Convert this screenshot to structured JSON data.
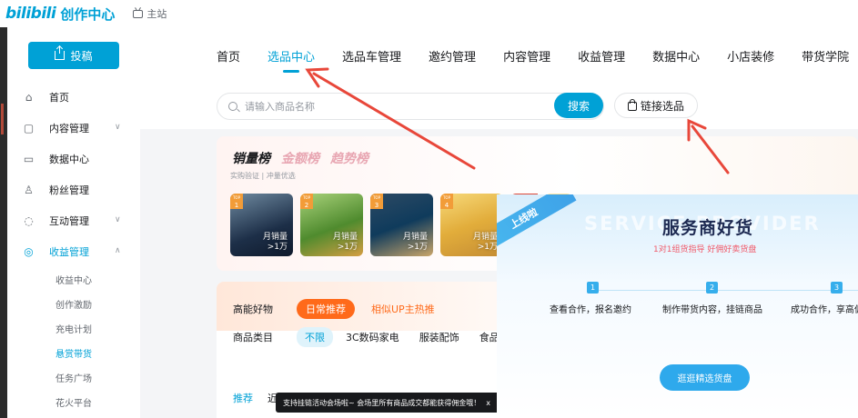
{
  "header": {
    "logo_mark": "bilibili",
    "logo_text": "创作中心",
    "home_link": "主站"
  },
  "sidebar": {
    "upload_label": "投稿",
    "items": [
      {
        "label": "首页",
        "icon": "home-icon"
      },
      {
        "label": "内容管理",
        "icon": "content-icon",
        "chevron": "∨"
      },
      {
        "label": "数据中心",
        "icon": "data-icon"
      },
      {
        "label": "粉丝管理",
        "icon": "fans-icon"
      },
      {
        "label": "互动管理",
        "icon": "interact-icon",
        "chevron": "∨"
      },
      {
        "label": "收益管理",
        "icon": "revenue-icon",
        "chevron": "∧"
      }
    ],
    "sub_items": [
      "收益中心",
      "创作激励",
      "充电计划",
      "悬赏带货",
      "任务广场",
      "花火平台"
    ]
  },
  "tabs": [
    "首页",
    "选品中心",
    "选品车管理",
    "邀约管理",
    "内容管理",
    "收益管理",
    "数据中心",
    "小店装修",
    "带货学院"
  ],
  "search": {
    "placeholder": "请输入商品名称",
    "button_label": "搜索",
    "link_select_label": "链接选品"
  },
  "ranking": {
    "tabs": [
      "销量榜",
      "金额榜",
      "趋势榜"
    ],
    "subtitle": "实购验证 | 冲量优选",
    "products": [
      {
        "rank": "1",
        "badge": "TOP",
        "sales_label": "月销量",
        "sales_value": ">1万"
      },
      {
        "rank": "2",
        "badge": "TOP",
        "sales_label": "月销量",
        "sales_value": ">1万"
      },
      {
        "rank": "3",
        "badge": "TOP",
        "sales_label": "月销量",
        "sales_value": ">1万"
      },
      {
        "rank": "4",
        "badge": "TOP",
        "sales_label": "月销量",
        "sales_value": ">1万"
      }
    ]
  },
  "category": {
    "head_label": "高能好物",
    "pill_on": "日常推荐",
    "pill_off": "相似UP主热推",
    "filter_label": "商品类目",
    "filters": [
      "不限",
      "3C数码家电",
      "服装配饰",
      "食品"
    ]
  },
  "list_tabs": [
    "推荐",
    "近"
  ],
  "tooltip": {
    "text": "支持挂链活动会场啦~ 会场里所有商品成交都能获得佣金哦！",
    "close": "x"
  },
  "promo": {
    "ribbon": "上线啦",
    "bg_text": "SERVICE PROVIDER",
    "title": "服务商好货",
    "subtitle": "1对1组货指导 好佣好卖货盘",
    "steps": [
      {
        "num": "1",
        "text": "查看合作，报名邀约"
      },
      {
        "num": "2",
        "text": "制作带货内容，挂链商品"
      },
      {
        "num": "3",
        "text": "成功合作，享高佣"
      }
    ],
    "button": "逛逛精选货盘"
  },
  "colors": {
    "accent": "#00a1d6",
    "orange": "#ff6a1a",
    "annotation": "#e8473a"
  }
}
